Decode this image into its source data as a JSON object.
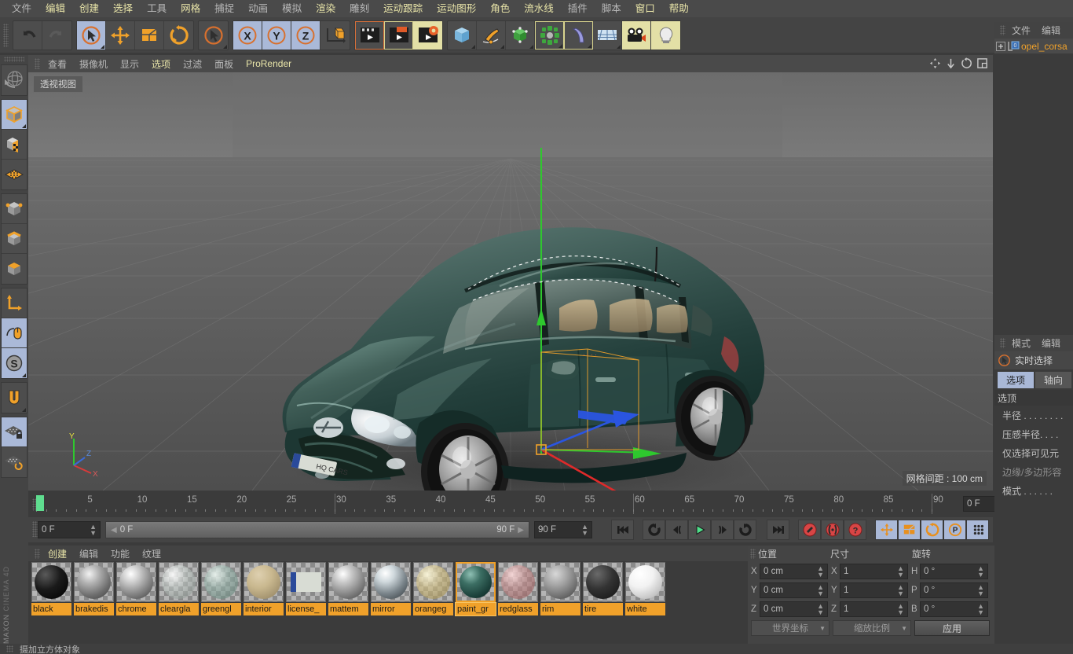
{
  "app": {
    "brand_line1": "MAXON",
    "brand_line2": "CINEMA 4D"
  },
  "menubar": {
    "items": [
      {
        "label": "文件",
        "style": "gray"
      },
      {
        "label": "编辑",
        "style": "yellow"
      },
      {
        "label": "创建",
        "style": "yellow"
      },
      {
        "label": "选择",
        "style": "yellow"
      },
      {
        "label": "工具",
        "style": "gray"
      },
      {
        "label": "网格",
        "style": "yellow"
      },
      {
        "label": "捕捉",
        "style": "gray"
      },
      {
        "label": "动画",
        "style": "gray"
      },
      {
        "label": "模拟",
        "style": "gray"
      },
      {
        "label": "渲染",
        "style": "yellow"
      },
      {
        "label": "雕刻",
        "style": "gray"
      },
      {
        "label": "运动跟踪",
        "style": "yellow"
      },
      {
        "label": "运动图形",
        "style": "yellow"
      },
      {
        "label": "角色",
        "style": "yellow"
      },
      {
        "label": "流水线",
        "style": "yellow"
      },
      {
        "label": "插件",
        "style": "gray"
      },
      {
        "label": "脚本",
        "style": "gray"
      },
      {
        "label": "窗口",
        "style": "yellow"
      },
      {
        "label": "帮助",
        "style": "yellow"
      }
    ]
  },
  "toolbar": {
    "icons": [
      {
        "name": "undo-icon",
        "state": "normal"
      },
      {
        "name": "redo-icon",
        "state": "disabled"
      },
      {
        "name": "live-selection-icon",
        "state": "selected"
      },
      {
        "name": "move-icon",
        "state": "normal"
      },
      {
        "name": "scale-icon",
        "state": "normal"
      },
      {
        "name": "rotate-icon",
        "state": "normal"
      },
      {
        "name": "selection-mode-icon",
        "state": "normal"
      },
      {
        "name": "axis-x-icon",
        "state": "selected"
      },
      {
        "name": "axis-y-icon",
        "state": "selected"
      },
      {
        "name": "axis-z-icon",
        "state": "selected"
      },
      {
        "name": "world-coordinate-icon",
        "state": "normal"
      },
      {
        "name": "render-view-icon",
        "state": "redframe"
      },
      {
        "name": "render-region-icon",
        "state": "yellowframe"
      },
      {
        "name": "render-settings-icon",
        "state": "yellow"
      },
      {
        "name": "primitive-cube-icon",
        "state": "normal"
      },
      {
        "name": "spline-pen-icon",
        "state": "normal"
      },
      {
        "name": "generator-icon",
        "state": "normal"
      },
      {
        "name": "array-icon",
        "state": "yellowframe"
      },
      {
        "name": "bend-deformer-icon",
        "state": "yellowframe"
      },
      {
        "name": "floor-environment-icon",
        "state": "normal"
      },
      {
        "name": "camera-icon",
        "state": "yellow"
      },
      {
        "name": "light-icon",
        "state": "yellow"
      }
    ]
  },
  "left_toolbar": {
    "icons": [
      {
        "name": "undo-view-icon",
        "state": "normal"
      },
      {
        "name": "model-mode-icon",
        "state": "selected"
      },
      {
        "name": "texture-mode-icon",
        "state": "normal"
      },
      {
        "name": "polygon-grid-icon",
        "state": "normal"
      },
      {
        "name": "points-mode-icon",
        "state": "normal"
      },
      {
        "name": "edges-mode-icon",
        "state": "normal"
      },
      {
        "name": "polygons-mode-icon",
        "state": "normal"
      },
      {
        "name": "axis-modify-icon",
        "state": "normal"
      },
      {
        "name": "enable-snap-icon",
        "state": "selected"
      },
      {
        "name": "soft-selection-icon",
        "state": "selected"
      },
      {
        "name": "magnet-icon",
        "state": "normal"
      },
      {
        "name": "lock-workplane-icon",
        "state": "selected"
      },
      {
        "name": "workplane-rotate-icon",
        "state": "normal"
      }
    ]
  },
  "viewport": {
    "menu": [
      {
        "label": "查看",
        "style": "gray"
      },
      {
        "label": "摄像机",
        "style": "gray"
      },
      {
        "label": "显示",
        "style": "gray"
      },
      {
        "label": "选项",
        "style": "yellow"
      },
      {
        "label": "过滤",
        "style": "gray"
      },
      {
        "label": "面板",
        "style": "gray"
      },
      {
        "label": "ProRender",
        "style": "yellow"
      }
    ],
    "view_tag": "透视视图",
    "grid_info": "网格间距 : 100 cm",
    "axis_labels": {
      "x": "X",
      "y": "Y",
      "z": "Z"
    },
    "scene_object": "opel_corsa"
  },
  "timeline": {
    "ticks": [
      0,
      5,
      10,
      15,
      20,
      25,
      30,
      35,
      40,
      45,
      50,
      55,
      60,
      65,
      70,
      75,
      80,
      85,
      90
    ],
    "range_min": 0,
    "range_max": 90,
    "current_frame_field": "0 F",
    "start_field": "0 F",
    "start_bar_label": "0 F",
    "end_bar_label": "90 F",
    "end_field": "90 F",
    "transport": [
      {
        "name": "go-to-start-button"
      },
      {
        "name": "previous-keyframe-button"
      },
      {
        "name": "step-back-button"
      },
      {
        "name": "play-button"
      },
      {
        "name": "step-forward-button"
      },
      {
        "name": "next-keyframe-button"
      },
      {
        "name": "go-to-end-button"
      }
    ],
    "record_buttons": [
      {
        "name": "record-active-objects-button"
      },
      {
        "name": "autokeying-button"
      },
      {
        "name": "keyframe-selection-button"
      }
    ],
    "keyframe_toggles": [
      {
        "name": "position-key-icon",
        "state": "selected"
      },
      {
        "name": "scale-key-icon",
        "state": "selected"
      },
      {
        "name": "rotation-key-icon",
        "state": "selected"
      },
      {
        "name": "parameter-key-icon",
        "state": "selected"
      },
      {
        "name": "point-level-animation-icon",
        "state": "selected"
      }
    ],
    "layout_button": {
      "name": "timeline-layout-button"
    }
  },
  "material_manager": {
    "menu": [
      {
        "label": "创建",
        "style": "yellow"
      },
      {
        "label": "编辑",
        "style": "gray"
      },
      {
        "label": "功能",
        "style": "gray"
      },
      {
        "label": "纹理",
        "style": "gray"
      }
    ],
    "materials": [
      {
        "name": "black",
        "selected": false,
        "swatch": "black"
      },
      {
        "name": "brakedis",
        "selected": false,
        "swatch": "brushed"
      },
      {
        "name": "chrome",
        "selected": false,
        "swatch": "chrome"
      },
      {
        "name": "cleargla",
        "selected": false,
        "swatch": "glass"
      },
      {
        "name": "greengl",
        "selected": false,
        "swatch": "greenglass"
      },
      {
        "name": "interior",
        "selected": false,
        "swatch": "tan"
      },
      {
        "name": "license_",
        "selected": false,
        "swatch": "plate"
      },
      {
        "name": "mattem",
        "selected": false,
        "swatch": "mattemetal"
      },
      {
        "name": "mirror",
        "selected": false,
        "swatch": "mirror"
      },
      {
        "name": "orangeg",
        "selected": false,
        "swatch": "orangeglass"
      },
      {
        "name": "paint_gr",
        "selected": true,
        "swatch": "greenpaint"
      },
      {
        "name": "redglass",
        "selected": false,
        "swatch": "redglass"
      },
      {
        "name": "rim",
        "selected": false,
        "swatch": "rim"
      },
      {
        "name": "tire",
        "selected": false,
        "swatch": "tire"
      },
      {
        "name": "white",
        "selected": false,
        "swatch": "white"
      }
    ]
  },
  "coordinates": {
    "headers": {
      "position": "位置",
      "size": "尺寸",
      "rotation": "旋转"
    },
    "rows": [
      {
        "pos_label": "X",
        "pos_value": "0 cm",
        "size_label": "X",
        "size_value": "1",
        "rot_label": "H",
        "rot_value": "0 °"
      },
      {
        "pos_label": "Y",
        "pos_value": "0 cm",
        "size_label": "Y",
        "size_value": "1",
        "rot_label": "P",
        "rot_value": "0 °"
      },
      {
        "pos_label": "Z",
        "pos_value": "0 cm",
        "size_label": "Z",
        "size_value": "1",
        "rot_label": "B",
        "rot_value": "0 °"
      }
    ],
    "coord_system": "世界坐标",
    "scale_mode": "缩放比例",
    "apply_label": "应用"
  },
  "object_manager": {
    "menu": [
      {
        "label": "文件",
        "style": "gray"
      },
      {
        "label": "编辑",
        "style": "gray"
      }
    ],
    "rows": [
      {
        "label": "opel_corsa",
        "expanded": false,
        "tag": "0"
      }
    ]
  },
  "attribute_manager": {
    "menu": [
      {
        "label": "模式",
        "style": "gray"
      },
      {
        "label": "编辑",
        "style": "gray"
      }
    ],
    "tool_label": "实时选择",
    "tabs": [
      {
        "label": "选项",
        "selected": true
      },
      {
        "label": "轴向",
        "selected": false
      }
    ],
    "section_label": "选顶",
    "rows": [
      {
        "label": "半径 . . . . . . . .",
        "dim": false
      },
      {
        "label": "压感半径. . . .",
        "dim": false
      },
      {
        "label": "仅选择可见元",
        "dim": false
      },
      {
        "label": "边缘/多边形容",
        "dim": true
      },
      {
        "label": "模式 . . . . . .",
        "dim": false
      }
    ]
  },
  "status_bar": {
    "message": "摄加立方体对象"
  },
  "colors": {
    "accent_orange": "#f0a12a",
    "selection_blue": "#aab9d8",
    "menu_yellow": "#e8e4a8",
    "panel_bg": "#444444",
    "dark_bg": "#3b3b3b"
  }
}
